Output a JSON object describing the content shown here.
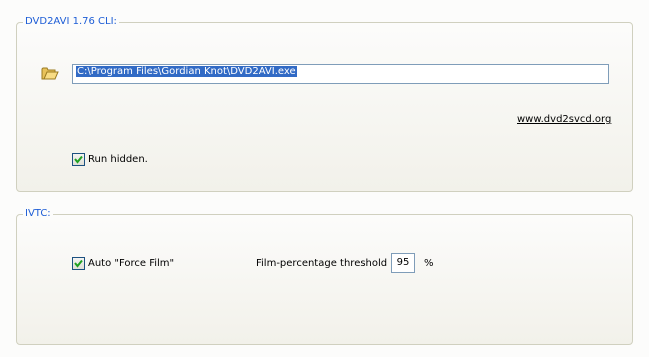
{
  "dvd2avi_group": {
    "title": "DVD2AVI 1.76 CLI:",
    "path_value": "C:\\Program Files\\Gordian Knot\\DVD2AVI.exe",
    "link_text": "www.dvd2svcd.org",
    "run_hidden_label": "Run hidden.",
    "run_hidden_checked": true
  },
  "ivtc_group": {
    "title": "IVTC:",
    "auto_force_film_label": "Auto \"Force Film\"",
    "auto_force_film_checked": true,
    "threshold_label": "Film-percentage threshold",
    "threshold_value": "95",
    "threshold_unit": "%"
  },
  "icons": {
    "browse": "folder-open-icon",
    "checkmark": "checkmark-icon"
  }
}
